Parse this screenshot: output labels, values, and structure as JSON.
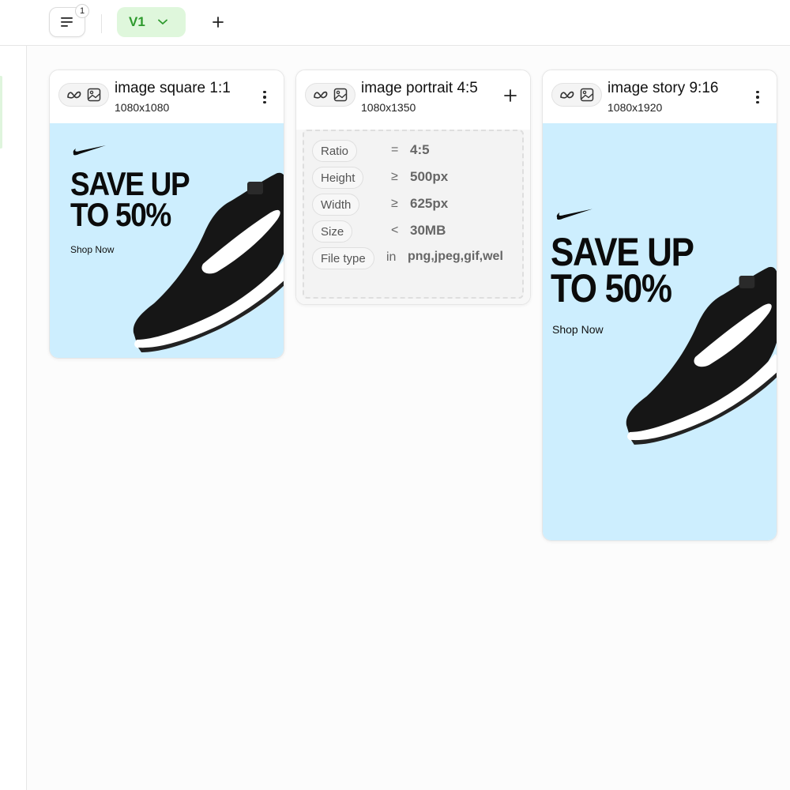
{
  "toolbar": {
    "menu_badge": "1",
    "version_label": "V1"
  },
  "cards": [
    {
      "title": "image square 1:1",
      "size": "1080x1080",
      "ad": {
        "headline_line1": "SAVE UP",
        "headline_line2": "TO 50%",
        "cta": "Shop Now"
      }
    },
    {
      "title": "image portrait 4:5",
      "size": "1080x1350",
      "specs": [
        {
          "label": "Ratio",
          "op": "=",
          "value": "4:5"
        },
        {
          "label": "Height",
          "op": "≥",
          "value": "500px"
        },
        {
          "label": "Width",
          "op": "≥",
          "value": "625px"
        },
        {
          "label": "Size",
          "op": "<",
          "value": "30MB"
        },
        {
          "label": "File type",
          "op": "in",
          "value": "png,jpeg,gif,wel"
        }
      ]
    },
    {
      "title": "image story 9:16",
      "size": "1080x1920",
      "ad": {
        "headline_line1": "SAVE UP",
        "headline_line2": "TO 50%",
        "cta": "Shop Now"
      }
    }
  ],
  "colors": {
    "version_bg": "#dff7dc",
    "version_text": "#2e9a2e",
    "ad_bg": "#cdeefe",
    "bubble": "#5aa9e6"
  }
}
